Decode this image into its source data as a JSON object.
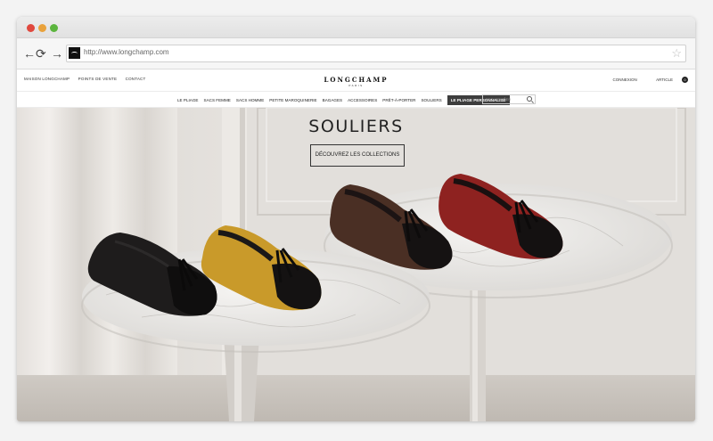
{
  "browser": {
    "url": "http://www.longchamp.com"
  },
  "site": {
    "top_links": [
      "MAISON LONGCHAMP",
      "POINTS DE VENTE",
      "CONTACT"
    ],
    "logo": "LONGCHAMP",
    "logo_sub": "PARIS",
    "account": {
      "connexion": "CONNEXION",
      "article": "ARTICLE",
      "count": "0"
    },
    "nav": [
      "LE PLIAGE",
      "SACS FEMME",
      "SACS HOMME",
      "PETITE MAROQUINERIE",
      "BAGAGES",
      "ACCESSOIRES",
      "PRÊT-À-PORTER",
      "SOULIERS"
    ],
    "nav_highlight": "LE PLIAGE PERSONNALISÉ",
    "search_placeholder": "RECHERCHER"
  },
  "hero": {
    "title": "SOULIERS",
    "button": "DÉCOUVREZ LES COLLECTIONS"
  }
}
